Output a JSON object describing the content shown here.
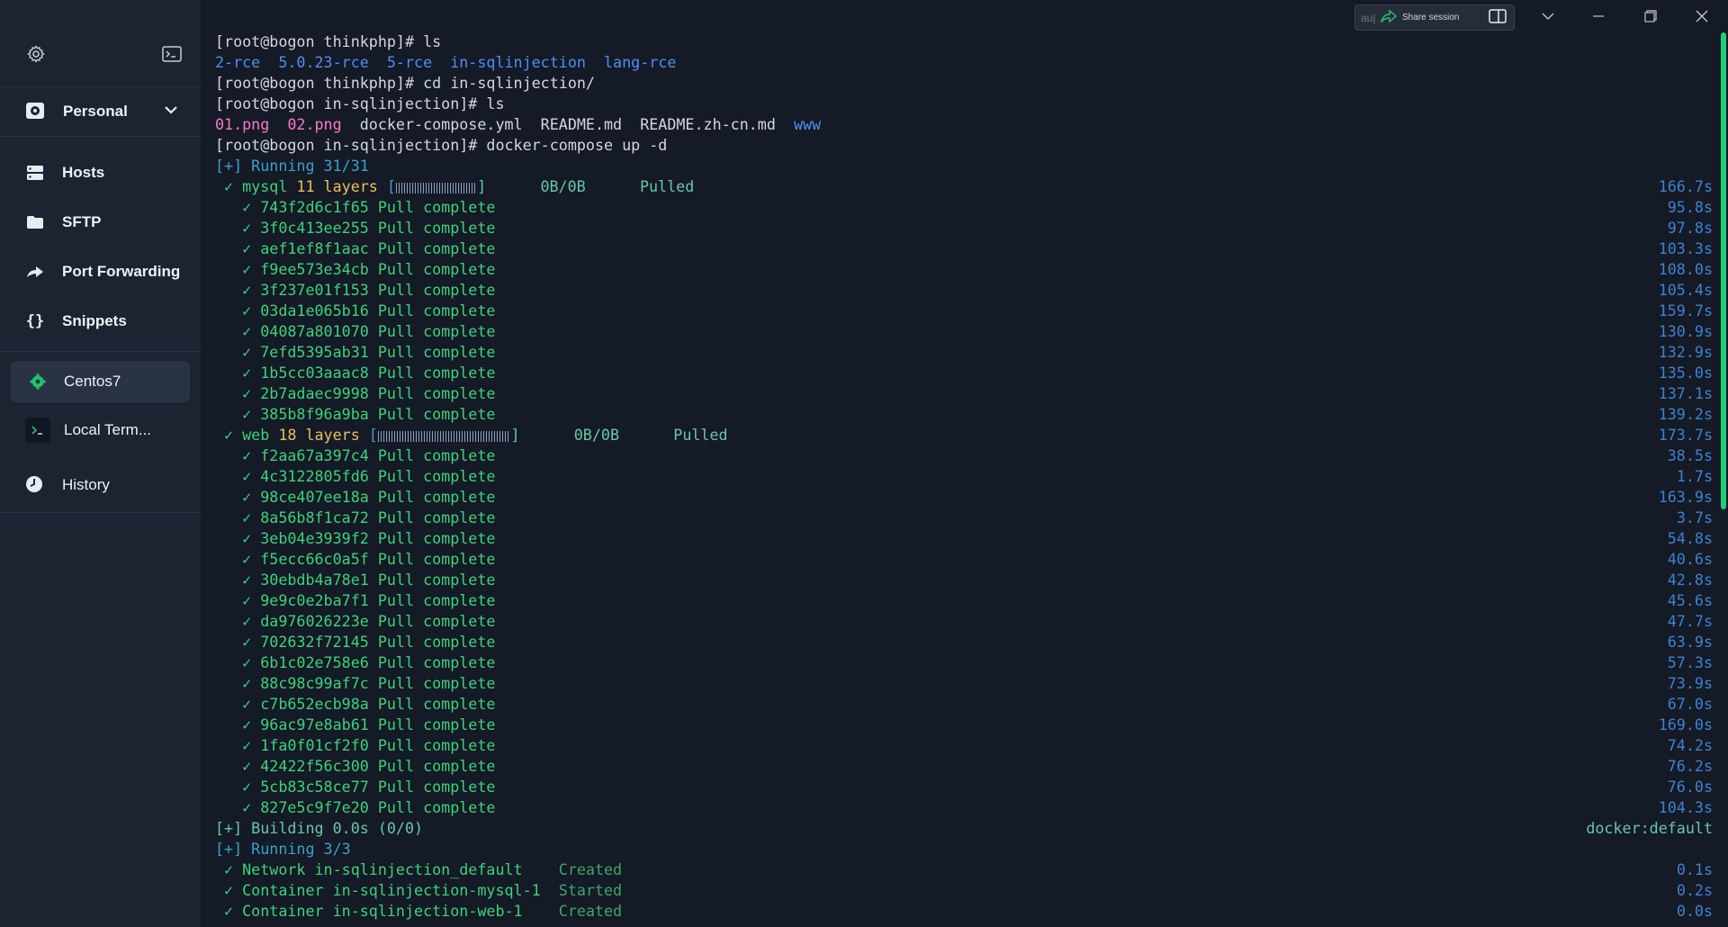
{
  "sidebar": {
    "vault_label": "Personal",
    "nav": [
      {
        "label": "Hosts",
        "icon": "hosts-icon"
      },
      {
        "label": "SFTP",
        "icon": "folder-icon"
      },
      {
        "label": "Port Forwarding",
        "icon": "port-forward-icon"
      },
      {
        "label": "Snippets",
        "icon": "braces-icon"
      }
    ],
    "sessions": [
      {
        "label": "Centos7",
        "icon": "gear-green-icon",
        "active": true
      },
      {
        "label": "Local Term...",
        "icon": "terminal-icon",
        "active": false
      }
    ],
    "history_label": "History"
  },
  "topbar": {
    "share_placeholder": "au|",
    "share_label": "Share session"
  },
  "terminal": {
    "lines": [
      {
        "segs": [
          {
            "t": "[root@bogon thinkphp]# ls",
            "c": ""
          }
        ]
      },
      {
        "segs": [
          {
            "t": "2-rce",
            "c": "c-blue"
          },
          {
            "t": "  ",
            "c": ""
          },
          {
            "t": "5.0.23-rce",
            "c": "c-blue"
          },
          {
            "t": "  ",
            "c": ""
          },
          {
            "t": "5-rce",
            "c": "c-blue"
          },
          {
            "t": "  ",
            "c": ""
          },
          {
            "t": "in-sqlinjection",
            "c": "c-blue"
          },
          {
            "t": "  ",
            "c": ""
          },
          {
            "t": "lang-rce",
            "c": "c-blue"
          }
        ]
      },
      {
        "segs": [
          {
            "t": "[root@bogon thinkphp]# cd in-sqlinjection/",
            "c": ""
          }
        ]
      },
      {
        "segs": [
          {
            "t": "[root@bogon in-sqlinjection]# ls",
            "c": ""
          }
        ]
      },
      {
        "segs": [
          {
            "t": "01.png",
            "c": "c-pink"
          },
          {
            "t": "  ",
            "c": ""
          },
          {
            "t": "02.png",
            "c": "c-pink"
          },
          {
            "t": "  docker-compose.yml  README.md  README.zh-cn.md  ",
            "c": ""
          },
          {
            "t": "www",
            "c": "c-blue"
          }
        ]
      },
      {
        "segs": [
          {
            "t": "[root@bogon in-sqlinjection]# docker-compose up -d",
            "c": ""
          }
        ]
      },
      {
        "segs": [
          {
            "t": "[+] Running 31/31",
            "c": "c-run"
          }
        ]
      },
      {
        "segs": [
          {
            "t": " ✓ mysql ",
            "c": "c-green"
          },
          {
            "t": "11 layers",
            "c": "c-yellow"
          },
          {
            "t": " [",
            "c": "c-dim"
          },
          {
            "bar": 11
          },
          {
            "t": "]      0B/0B      Pulled",
            "c": "c-cyan"
          }
        ],
        "right": "166.7s"
      },
      {
        "segs": [
          {
            "t": "   ✓ 743f2d6c1f65 Pull complete",
            "c": "c-green"
          }
        ],
        "right": "95.8s"
      },
      {
        "segs": [
          {
            "t": "   ✓ 3f0c413ee255 Pull complete",
            "c": "c-green"
          }
        ],
        "right": "97.8s"
      },
      {
        "segs": [
          {
            "t": "   ✓ aef1ef8f1aac Pull complete",
            "c": "c-green"
          }
        ],
        "right": "103.3s"
      },
      {
        "segs": [
          {
            "t": "   ✓ f9ee573e34cb Pull complete",
            "c": "c-green"
          }
        ],
        "right": "108.0s"
      },
      {
        "segs": [
          {
            "t": "   ✓ 3f237e01f153 Pull complete",
            "c": "c-green"
          }
        ],
        "right": "105.4s"
      },
      {
        "segs": [
          {
            "t": "   ✓ 03da1e065b16 Pull complete",
            "c": "c-green"
          }
        ],
        "right": "159.7s"
      },
      {
        "segs": [
          {
            "t": "   ✓ 04087a801070 Pull complete",
            "c": "c-green"
          }
        ],
        "right": "130.9s"
      },
      {
        "segs": [
          {
            "t": "   ✓ 7efd5395ab31 Pull complete",
            "c": "c-green"
          }
        ],
        "right": "132.9s"
      },
      {
        "segs": [
          {
            "t": "   ✓ 1b5cc03aaac8 Pull complete",
            "c": "c-green"
          }
        ],
        "right": "135.0s"
      },
      {
        "segs": [
          {
            "t": "   ✓ 2b7adaec9998 Pull complete",
            "c": "c-green"
          }
        ],
        "right": "137.1s"
      },
      {
        "segs": [
          {
            "t": "   ✓ 385b8f96a9ba Pull complete",
            "c": "c-green"
          }
        ],
        "right": "139.2s"
      },
      {
        "segs": [
          {
            "t": " ✓ web ",
            "c": "c-green"
          },
          {
            "t": "18 layers",
            "c": "c-yellow"
          },
          {
            "t": " [",
            "c": "c-dim"
          },
          {
            "bar": 18
          },
          {
            "t": "]      0B/0B      Pulled",
            "c": "c-cyan"
          }
        ],
        "right": "173.7s"
      },
      {
        "segs": [
          {
            "t": "   ✓ f2aa67a397c4 Pull complete",
            "c": "c-green"
          }
        ],
        "right": "38.5s"
      },
      {
        "segs": [
          {
            "t": "   ✓ 4c3122805fd6 Pull complete",
            "c": "c-green"
          }
        ],
        "right": "1.7s"
      },
      {
        "segs": [
          {
            "t": "   ✓ 98ce407ee18a Pull complete",
            "c": "c-green"
          }
        ],
        "right": "163.9s"
      },
      {
        "segs": [
          {
            "t": "   ✓ 8a56b8f1ca72 Pull complete",
            "c": "c-green"
          }
        ],
        "right": "3.7s"
      },
      {
        "segs": [
          {
            "t": "   ✓ 3eb04e3939f2 Pull complete",
            "c": "c-green"
          }
        ],
        "right": "54.8s"
      },
      {
        "segs": [
          {
            "t": "   ✓ f5ecc66c0a5f Pull complete",
            "c": "c-green"
          }
        ],
        "right": "40.6s"
      },
      {
        "segs": [
          {
            "t": "   ✓ 30ebdb4a78e1 Pull complete",
            "c": "c-green"
          }
        ],
        "right": "42.8s"
      },
      {
        "segs": [
          {
            "t": "   ✓ 9e9c0e2ba7f1 Pull complete",
            "c": "c-green"
          }
        ],
        "right": "45.6s"
      },
      {
        "segs": [
          {
            "t": "   ✓ da976026223e Pull complete",
            "c": "c-green"
          }
        ],
        "right": "47.7s"
      },
      {
        "segs": [
          {
            "t": "   ✓ 702632f72145 Pull complete",
            "c": "c-green"
          }
        ],
        "right": "63.9s"
      },
      {
        "segs": [
          {
            "t": "   ✓ 6b1c02e758e6 Pull complete",
            "c": "c-green"
          }
        ],
        "right": "57.3s"
      },
      {
        "segs": [
          {
            "t": "   ✓ 88c98c99af7c Pull complete",
            "c": "c-green"
          }
        ],
        "right": "73.9s"
      },
      {
        "segs": [
          {
            "t": "   ✓ c7b652ecb98a Pull complete",
            "c": "c-green"
          }
        ],
        "right": "67.0s"
      },
      {
        "segs": [
          {
            "t": "   ✓ 96ac97e8ab61 Pull complete",
            "c": "c-green"
          }
        ],
        "right": "169.0s"
      },
      {
        "segs": [
          {
            "t": "   ✓ 1fa0f01cf2f0 Pull complete",
            "c": "c-green"
          }
        ],
        "right": "74.2s"
      },
      {
        "segs": [
          {
            "t": "   ✓ 42422f56c300 Pull complete",
            "c": "c-green"
          }
        ],
        "right": "76.2s"
      },
      {
        "segs": [
          {
            "t": "   ✓ 5cb83c58ce77 Pull complete",
            "c": "c-green"
          }
        ],
        "right": "76.0s"
      },
      {
        "segs": [
          {
            "t": "   ✓ 827e5c9f7e20 Pull complete",
            "c": "c-green"
          }
        ],
        "right": "104.3s"
      },
      {
        "segs": [
          {
            "t": "[+] Building 0.0s (0/0)",
            "c": "c-cyan"
          }
        ],
        "right": "docker:default",
        "rightClass": "c-cyan"
      },
      {
        "segs": [
          {
            "t": "[+] Running 3/3",
            "c": "c-run"
          }
        ]
      },
      {
        "segs": [
          {
            "t": " ✓ Network in-sqlinjection_default    ",
            "c": "c-green"
          },
          {
            "t": "Created",
            "c": "c-cre"
          }
        ],
        "right": "0.1s"
      },
      {
        "segs": [
          {
            "t": " ✓ Container in-sqlinjection-mysql-1  ",
            "c": "c-green"
          },
          {
            "t": "Started",
            "c": "c-cre"
          }
        ],
        "right": "0.2s"
      },
      {
        "segs": [
          {
            "t": " ✓ Container in-sqlinjection-web-1    ",
            "c": "c-green"
          },
          {
            "t": "Created",
            "c": "c-cre"
          }
        ],
        "right": "0.0s"
      }
    ]
  }
}
